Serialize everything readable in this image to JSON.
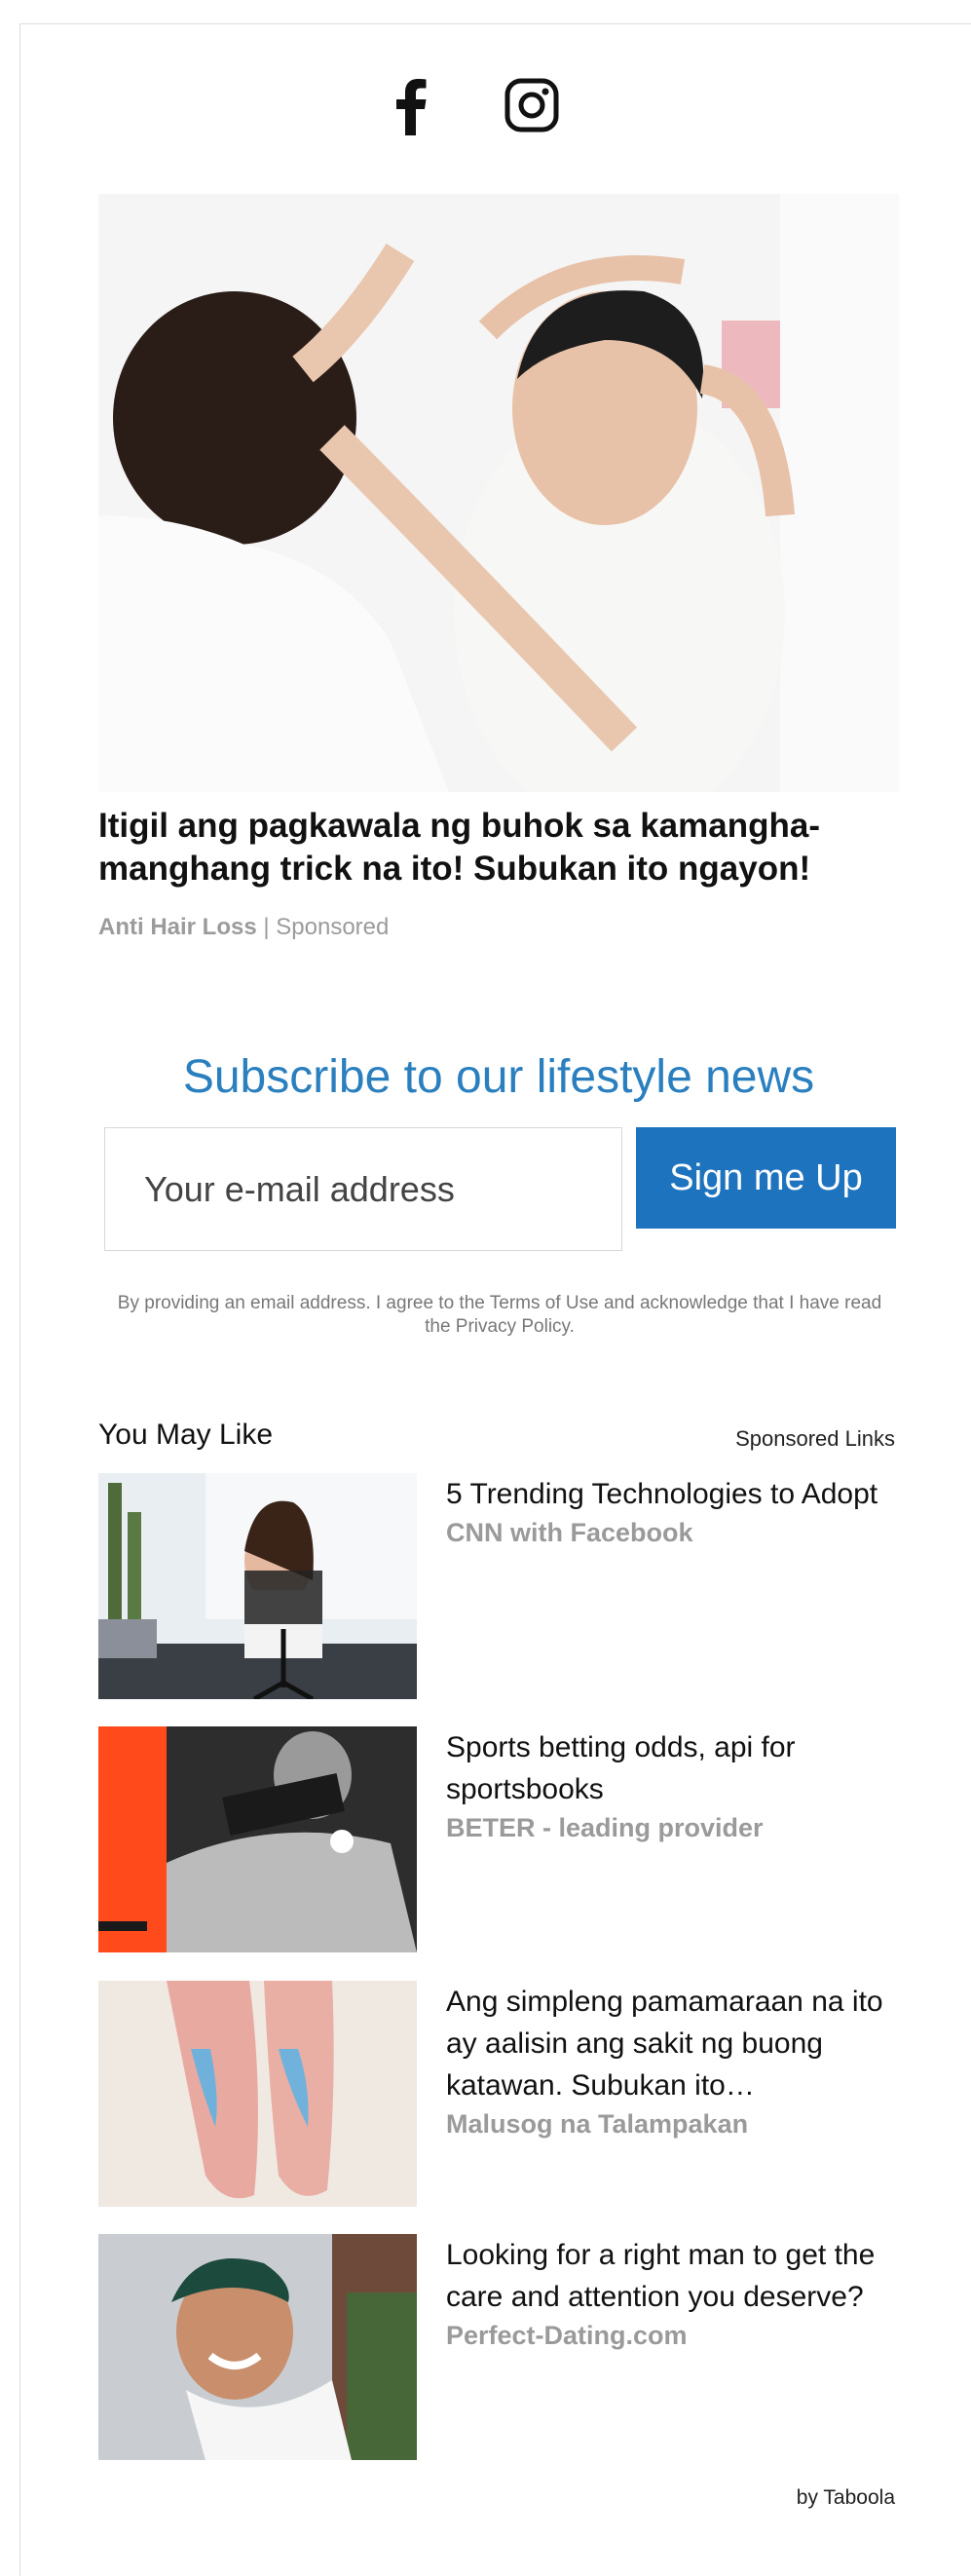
{
  "social": {
    "facebook_icon": "facebook-icon",
    "instagram_icon": "instagram-icon"
  },
  "hero": {
    "title": "Itigil ang pagkawala ng buhok sa kamangha-manghang trick na ito! Subukan ito ngayon!",
    "brand": "Anti Hair Loss",
    "separator": "|",
    "sponsored": "Sponsored"
  },
  "subscribe": {
    "title": "Subscribe to our lifestyle news",
    "email_placeholder": "Your e-mail address",
    "button_label": "Sign me Up",
    "legal": "By providing an email address. I agree to the Terms of Use and acknowledge that I have read the Privacy Policy."
  },
  "recommendations": {
    "heading": "You May Like",
    "sponsored_links": "Sponsored Links",
    "items": [
      {
        "headline": "5 Trending Technologies to Adopt",
        "source": "CNN with Facebook"
      },
      {
        "headline": "Sports betting odds, api for sportsbooks",
        "source": "BETER - leading provider"
      },
      {
        "headline": "Ang simpleng pamamaraan na ito ay aalisin ang sakit ng buong katawan. Subukan ito…",
        "source": "Malusog na Talampakan"
      },
      {
        "headline": "Looking for a right man to get the care and attention you deserve?",
        "source": "Perfect-Dating.com"
      }
    ],
    "attribution": "by Taboola"
  }
}
